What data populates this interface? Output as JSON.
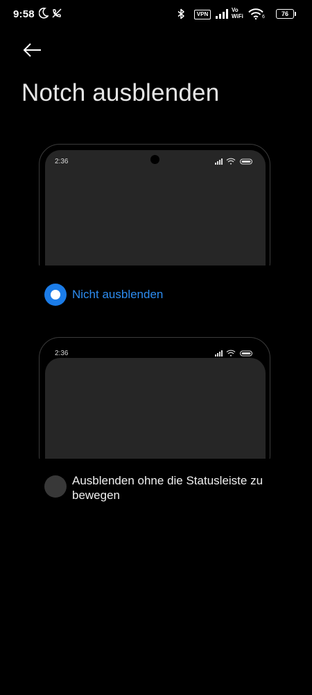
{
  "status_bar": {
    "time": "9:58",
    "vpn_label": "VPN",
    "vowifi_line1": "Vo",
    "vowifi_line2": "WiFi",
    "wifi_number": "6",
    "battery_level": "76",
    "icons": [
      "moon-icon",
      "muted-call-icon",
      "bluetooth-icon",
      "signal-icon",
      "wifi-icon",
      "battery-icon"
    ]
  },
  "header": {
    "back_icon": "arrow-left-icon",
    "title": "Notch ausblenden"
  },
  "previews": [
    {
      "clock": "2:36",
      "icons": [
        "signal-icon",
        "wifi-icon",
        "battery-icon"
      ]
    },
    {
      "clock": "2:36",
      "icons": [
        "signal-icon",
        "wifi-icon",
        "battery-icon"
      ]
    }
  ],
  "options": [
    {
      "label": "Nicht ausblenden",
      "selected": true
    },
    {
      "label": "Ausblenden ohne die Statusleiste zu bewegen",
      "selected": false
    }
  ],
  "colors": {
    "background": "#000000",
    "accent": "#1b7ce8",
    "accent_text": "#2d8cf0",
    "preview_screen": "#262626",
    "radio_unchecked": "#383838"
  }
}
